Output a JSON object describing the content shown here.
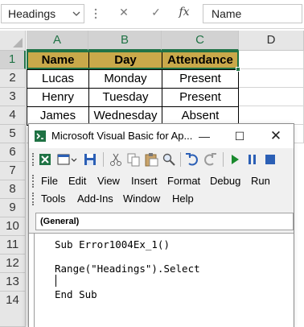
{
  "formula_bar": {
    "name_box": "Headings",
    "cancel_symbol": "✕",
    "enter_symbol": "✓",
    "fx_label": "fx",
    "formula_value": "Name"
  },
  "sheet": {
    "columns": [
      "A",
      "B",
      "C",
      "D"
    ],
    "rows": [
      "1",
      "2",
      "3",
      "4",
      "5",
      "6",
      "7",
      "8",
      "9",
      "10",
      "11",
      "12",
      "13",
      "14"
    ],
    "header_fill_color": "#c9a94a",
    "selection_color": "#217346",
    "cells": {
      "a1": "Name",
      "b1": "Day",
      "c1": "Attendance",
      "a2": "Lucas",
      "b2": "Monday",
      "c2": "Present",
      "a3": "Henry",
      "b3": "Tuesday",
      "c3": "Present",
      "a4": "James",
      "b4": "Wednesday",
      "c4": "Absent"
    }
  },
  "vba_window": {
    "title": "Microsoft Visual Basic for Ap...",
    "minimize_symbol": "—",
    "maximize_symbol": "☐",
    "close_symbol": "✕",
    "toolbar_icons": [
      "excel-icon",
      "insert-module-icon",
      "save-icon",
      "cut-icon",
      "copy-icon",
      "paste-icon",
      "find-icon",
      "undo-icon",
      "redo-icon",
      "run-icon",
      "break-icon",
      "reset-icon"
    ],
    "menu": {
      "file": "File",
      "edit": "Edit",
      "view": "View",
      "insert": "Insert",
      "format": "Format",
      "debug": "Debug",
      "run": "Run",
      "tools": "Tools",
      "addins": "Add-Ins",
      "window": "Window",
      "help": "Help"
    },
    "procedure_dropdown": "(General)",
    "code_lines": [
      "Sub Error1004Ex_1()",
      "Range(\"Headings\").Select",
      "End Sub"
    ]
  }
}
